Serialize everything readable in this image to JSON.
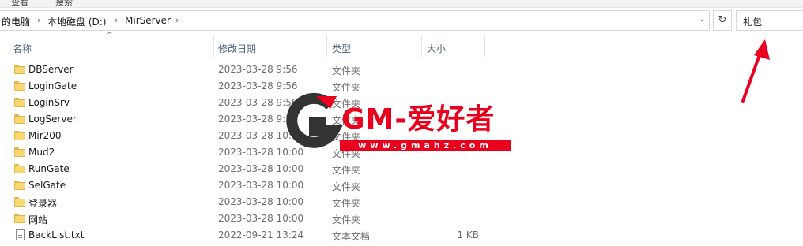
{
  "toolbar": {
    "left_text": "查看",
    "right_text": "搜索"
  },
  "address": {
    "crumbs": [
      "的电脑",
      "本地磁盘 (D:)",
      "MirServer"
    ],
    "dropdown_icon": "chevron-down-icon",
    "refresh_icon": "refresh-icon"
  },
  "search": {
    "value": "礼包"
  },
  "columns": {
    "name": "名称",
    "date": "修改日期",
    "type": "类型",
    "size": "大小"
  },
  "files": [
    {
      "name": "DBServer",
      "date": "2023-03-28 9:56",
      "type": "文件夹",
      "size": "",
      "icon": "folder-icon"
    },
    {
      "name": "LoginGate",
      "date": "2023-03-28 9:56",
      "type": "文件夹",
      "size": "",
      "icon": "folder-icon"
    },
    {
      "name": "LoginSrv",
      "date": "2023-03-28 9:56",
      "type": "文件夹",
      "size": "",
      "icon": "folder-icon"
    },
    {
      "name": "LogServer",
      "date": "2023-03-28 9:56",
      "type": "文件夹",
      "size": "",
      "icon": "folder-icon"
    },
    {
      "name": "Mir200",
      "date": "2023-03-28 10:00",
      "type": "文件夹",
      "size": "",
      "icon": "folder-icon"
    },
    {
      "name": "Mud2",
      "date": "2023-03-28 10:00",
      "type": "文件夹",
      "size": "",
      "icon": "folder-icon"
    },
    {
      "name": "RunGate",
      "date": "2023-03-28 10:00",
      "type": "文件夹",
      "size": "",
      "icon": "folder-icon"
    },
    {
      "name": "SelGate",
      "date": "2023-03-28 10:00",
      "type": "文件夹",
      "size": "",
      "icon": "folder-icon"
    },
    {
      "name": "登录器",
      "date": "2023-03-28 10:00",
      "type": "文件夹",
      "size": "",
      "icon": "folder-icon"
    },
    {
      "name": "网站",
      "date": "2023-03-28 10:00",
      "type": "文件夹",
      "size": "",
      "icon": "folder-icon"
    },
    {
      "name": "BackList.txt",
      "date": "2022-09-21 13:24",
      "type": "文本文档",
      "size": "1 KB",
      "icon": "text-file-icon"
    }
  ],
  "watermark": {
    "brand": "GM-爱好者",
    "url": "www.gmahz.com"
  },
  "colors": {
    "accent_red": "#e8001c",
    "folder_yellow": "#f8d775",
    "header_blue": "#4c607a"
  }
}
